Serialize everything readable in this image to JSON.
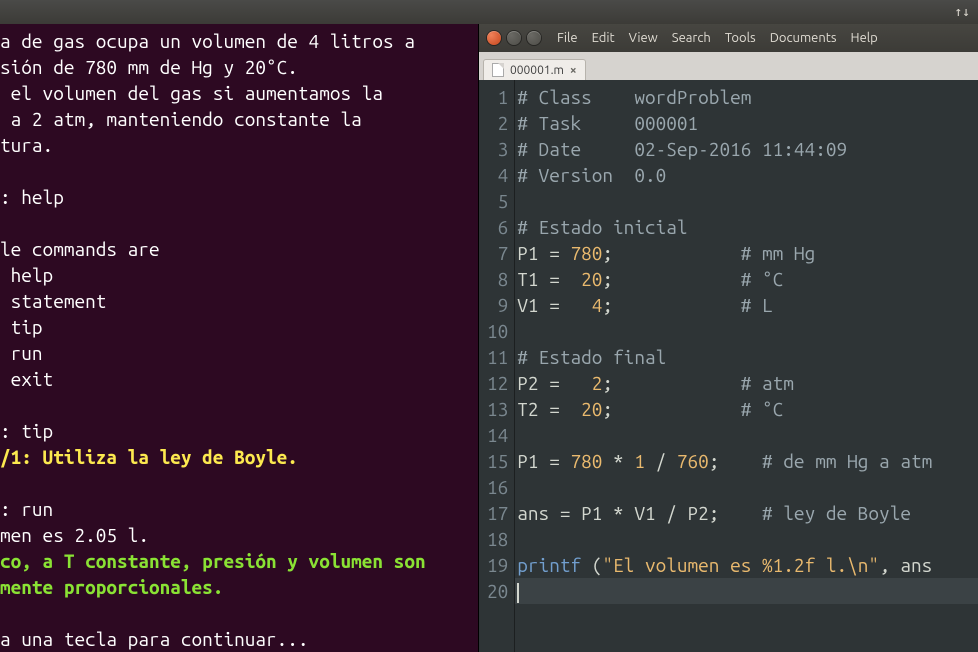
{
  "panel": {
    "net_icon": "↑↓"
  },
  "terminal": {
    "lines": [
      {
        "cls": "tw",
        "t": "a de gas ocupa un volumen de 4 litros a"
      },
      {
        "cls": "tw",
        "t": "sión de 780 mm de Hg y 20°C."
      },
      {
        "cls": "tw",
        "t": " el volumen del gas si aumentamos la"
      },
      {
        "cls": "tw",
        "t": " a 2 atm, manteniendo constante la"
      },
      {
        "cls": "tw",
        "t": "tura."
      },
      {
        "cls": "tw",
        "t": ""
      },
      {
        "cls": "tw",
        "t": ": help"
      },
      {
        "cls": "tw",
        "t": ""
      },
      {
        "cls": "tw",
        "t": "le commands are"
      },
      {
        "cls": "tw",
        "t": " help"
      },
      {
        "cls": "tw",
        "t": " statement"
      },
      {
        "cls": "tw",
        "t": " tip"
      },
      {
        "cls": "tw",
        "t": " run"
      },
      {
        "cls": "tw",
        "t": " exit"
      },
      {
        "cls": "tw",
        "t": ""
      },
      {
        "cls": "tw",
        "t": ": tip"
      },
      {
        "cls": "ty",
        "t": "/1: Utiliza la ley de Boyle."
      },
      {
        "cls": "tw",
        "t": ""
      },
      {
        "cls": "tw",
        "t": ": run"
      },
      {
        "cls": "tw",
        "t": "men es 2.05 l."
      },
      {
        "cls": "tg",
        "t": "co, a T constante, presión y volumen son"
      },
      {
        "cls": "tg",
        "t": "mente proporcionales."
      },
      {
        "cls": "tw",
        "t": ""
      },
      {
        "cls": "tw",
        "t": "a una tecla para continuar..."
      }
    ]
  },
  "editor": {
    "menu": [
      "File",
      "Edit",
      "View",
      "Search",
      "Tools",
      "Documents",
      "Help"
    ],
    "tab": {
      "name": "000001.m",
      "close": "×"
    },
    "lines": [
      {
        "n": 1,
        "seg": [
          {
            "c": "c-cmt",
            "t": "# Class    wordProblem"
          }
        ]
      },
      {
        "n": 2,
        "seg": [
          {
            "c": "c-cmt",
            "t": "# Task     000001"
          }
        ]
      },
      {
        "n": 3,
        "seg": [
          {
            "c": "c-cmt",
            "t": "# Date     02-Sep-2016 11:44:09"
          }
        ]
      },
      {
        "n": 4,
        "seg": [
          {
            "c": "c-cmt",
            "t": "# Version  0.0"
          }
        ]
      },
      {
        "n": 5,
        "seg": []
      },
      {
        "n": 6,
        "seg": [
          {
            "c": "c-cmt",
            "t": "# Estado inicial"
          }
        ]
      },
      {
        "n": 7,
        "seg": [
          {
            "c": "c-var",
            "t": "P1 "
          },
          {
            "c": "c-eq",
            "t": "= "
          },
          {
            "c": "c-num",
            "t": "780"
          },
          {
            "c": "c-var",
            "t": ";            "
          },
          {
            "c": "c-cmt",
            "t": "# mm Hg"
          }
        ]
      },
      {
        "n": 8,
        "seg": [
          {
            "c": "c-var",
            "t": "T1 "
          },
          {
            "c": "c-eq",
            "t": "=  "
          },
          {
            "c": "c-num",
            "t": "20"
          },
          {
            "c": "c-var",
            "t": ";            "
          },
          {
            "c": "c-cmt",
            "t": "# °C"
          }
        ]
      },
      {
        "n": 9,
        "seg": [
          {
            "c": "c-var",
            "t": "V1 "
          },
          {
            "c": "c-eq",
            "t": "=   "
          },
          {
            "c": "c-num",
            "t": "4"
          },
          {
            "c": "c-var",
            "t": ";            "
          },
          {
            "c": "c-cmt",
            "t": "# L"
          }
        ]
      },
      {
        "n": 10,
        "seg": []
      },
      {
        "n": 11,
        "seg": [
          {
            "c": "c-cmt",
            "t": "# Estado final"
          }
        ]
      },
      {
        "n": 12,
        "seg": [
          {
            "c": "c-var",
            "t": "P2 "
          },
          {
            "c": "c-eq",
            "t": "=   "
          },
          {
            "c": "c-num",
            "t": "2"
          },
          {
            "c": "c-var",
            "t": ";            "
          },
          {
            "c": "c-cmt",
            "t": "# atm"
          }
        ]
      },
      {
        "n": 13,
        "seg": [
          {
            "c": "c-var",
            "t": "T2 "
          },
          {
            "c": "c-eq",
            "t": "=  "
          },
          {
            "c": "c-num",
            "t": "20"
          },
          {
            "c": "c-var",
            "t": ";            "
          },
          {
            "c": "c-cmt",
            "t": "# °C"
          }
        ]
      },
      {
        "n": 14,
        "seg": []
      },
      {
        "n": 15,
        "seg": [
          {
            "c": "c-var",
            "t": "P1 "
          },
          {
            "c": "c-eq",
            "t": "= "
          },
          {
            "c": "c-num",
            "t": "780"
          },
          {
            "c": "c-op",
            "t": " * "
          },
          {
            "c": "c-num",
            "t": "1"
          },
          {
            "c": "c-op",
            "t": " / "
          },
          {
            "c": "c-num",
            "t": "760"
          },
          {
            "c": "c-var",
            "t": ";    "
          },
          {
            "c": "c-cmt",
            "t": "# de mm Hg a atm"
          }
        ]
      },
      {
        "n": 16,
        "seg": []
      },
      {
        "n": 17,
        "seg": [
          {
            "c": "c-var",
            "t": "ans "
          },
          {
            "c": "c-eq",
            "t": "= "
          },
          {
            "c": "c-var",
            "t": "P1 "
          },
          {
            "c": "c-op",
            "t": "* "
          },
          {
            "c": "c-var",
            "t": "V1 "
          },
          {
            "c": "c-op",
            "t": "/ "
          },
          {
            "c": "c-var",
            "t": "P2;    "
          },
          {
            "c": "c-cmt",
            "t": "# ley de Boyle"
          }
        ]
      },
      {
        "n": 18,
        "seg": []
      },
      {
        "n": 19,
        "seg": [
          {
            "c": "c-fn",
            "t": "printf "
          },
          {
            "c": "c-var",
            "t": "("
          },
          {
            "c": "c-str",
            "t": "\"El volumen es %1.2f l.\\n\""
          },
          {
            "c": "c-var",
            "t": ", ans"
          }
        ]
      },
      {
        "n": 20,
        "seg": [],
        "current": true
      }
    ]
  }
}
